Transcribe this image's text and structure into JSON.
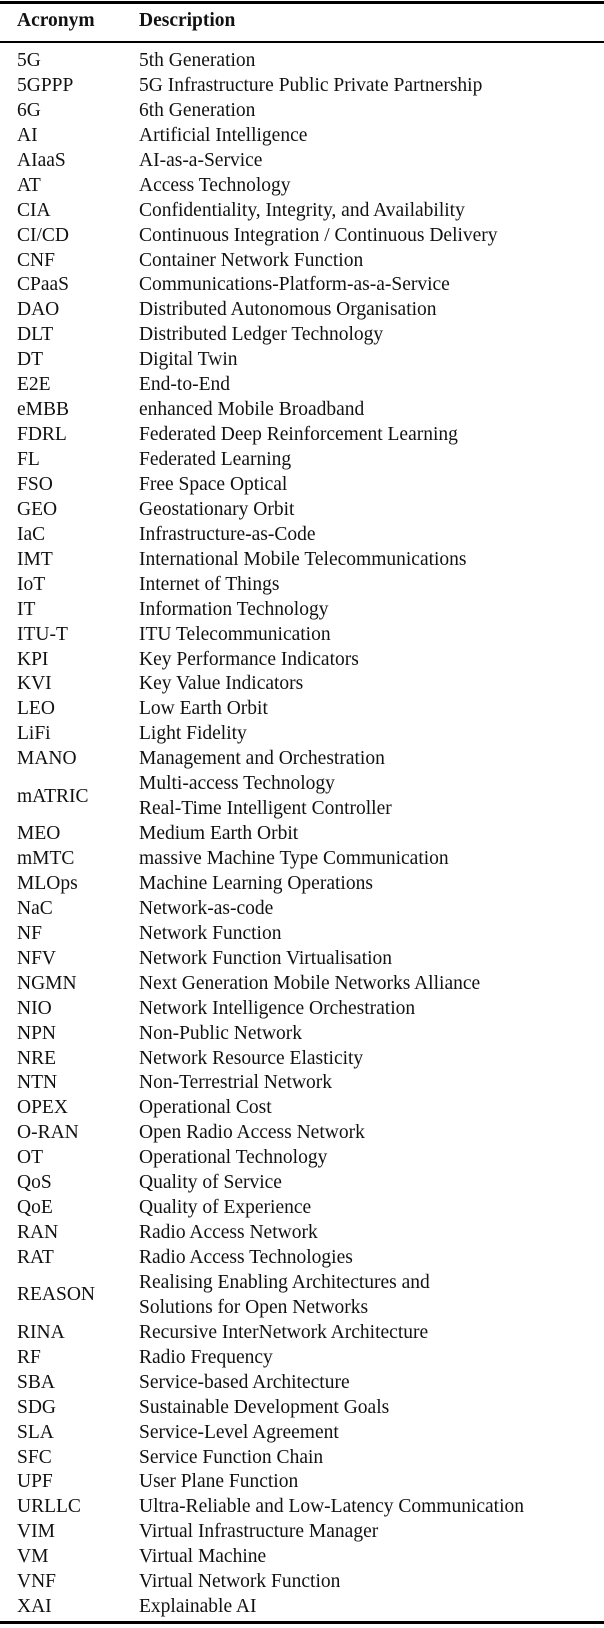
{
  "header": {
    "acronym": "Acronym",
    "description": "Description"
  },
  "rows": [
    {
      "acronym": "5G",
      "description": [
        "5th Generation"
      ]
    },
    {
      "acronym": "5GPPP",
      "description": [
        "5G Infrastructure Public Private Partnership"
      ]
    },
    {
      "acronym": "6G",
      "description": [
        "6th Generation"
      ]
    },
    {
      "acronym": "AI",
      "description": [
        "Artificial Intelligence"
      ]
    },
    {
      "acronym": "AIaaS",
      "description": [
        "AI-as-a-Service"
      ]
    },
    {
      "acronym": "AT",
      "description": [
        "Access Technology"
      ]
    },
    {
      "acronym": "CIA",
      "description": [
        "Confidentiality, Integrity, and Availability"
      ]
    },
    {
      "acronym": "CI/CD",
      "description": [
        "Continuous Integration / Continuous Delivery"
      ]
    },
    {
      "acronym": "CNF",
      "description": [
        "Container Network Function"
      ]
    },
    {
      "acronym": "CPaaS",
      "description": [
        "Communications-Platform-as-a-Service"
      ]
    },
    {
      "acronym": "DAO",
      "description": [
        "Distributed Autonomous Organisation"
      ]
    },
    {
      "acronym": "DLT",
      "description": [
        "Distributed Ledger Technology"
      ]
    },
    {
      "acronym": "DT",
      "description": [
        "Digital Twin"
      ]
    },
    {
      "acronym": "E2E",
      "description": [
        "End-to-End"
      ]
    },
    {
      "acronym": "eMBB",
      "description": [
        "enhanced Mobile Broadband"
      ]
    },
    {
      "acronym": "FDRL",
      "description": [
        "Federated Deep Reinforcement Learning"
      ]
    },
    {
      "acronym": "FL",
      "description": [
        "Federated Learning"
      ]
    },
    {
      "acronym": "FSO",
      "description": [
        "Free Space Optical"
      ]
    },
    {
      "acronym": "GEO",
      "description": [
        "Geostationary Orbit"
      ]
    },
    {
      "acronym": "IaC",
      "description": [
        "Infrastructure-as-Code"
      ]
    },
    {
      "acronym": "IMT",
      "description": [
        "International Mobile Telecommunications"
      ]
    },
    {
      "acronym": "IoT",
      "description": [
        "Internet of Things"
      ]
    },
    {
      "acronym": "IT",
      "description": [
        "Information Technology"
      ]
    },
    {
      "acronym": "ITU-T",
      "description": [
        "ITU Telecommunication"
      ]
    },
    {
      "acronym": "KPI",
      "description": [
        "Key Performance Indicators"
      ]
    },
    {
      "acronym": "KVI",
      "description": [
        "Key Value Indicators"
      ]
    },
    {
      "acronym": "LEO",
      "description": [
        "Low Earth Orbit"
      ]
    },
    {
      "acronym": "LiFi",
      "description": [
        "Light Fidelity"
      ]
    },
    {
      "acronym": "MANO",
      "description": [
        "Management and Orchestration"
      ]
    },
    {
      "acronym": "mATRIC",
      "description": [
        "Multi-access Technology",
        "Real-Time Intelligent Controller"
      ]
    },
    {
      "acronym": "MEO",
      "description": [
        "Medium Earth Orbit"
      ]
    },
    {
      "acronym": "mMTC",
      "description": [
        "massive Machine Type Communication"
      ]
    },
    {
      "acronym": "MLOps",
      "description": [
        "Machine Learning Operations"
      ]
    },
    {
      "acronym": "NaC",
      "description": [
        "Network-as-code"
      ]
    },
    {
      "acronym": "NF",
      "description": [
        "Network Function"
      ]
    },
    {
      "acronym": "NFV",
      "description": [
        "Network Function Virtualisation"
      ]
    },
    {
      "acronym": "NGMN",
      "description": [
        "Next Generation Mobile Networks Alliance"
      ]
    },
    {
      "acronym": "NIO",
      "description": [
        "Network Intelligence Orchestration"
      ]
    },
    {
      "acronym": "NPN",
      "description": [
        "Non-Public Network"
      ]
    },
    {
      "acronym": "NRE",
      "description": [
        "Network Resource Elasticity"
      ]
    },
    {
      "acronym": "NTN",
      "description": [
        "Non-Terrestrial Network"
      ]
    },
    {
      "acronym": "OPEX",
      "description": [
        "Operational Cost"
      ]
    },
    {
      "acronym": "O-RAN",
      "description": [
        "Open Radio Access Network"
      ]
    },
    {
      "acronym": "OT",
      "description": [
        "Operational Technology"
      ]
    },
    {
      "acronym": "QoS",
      "description": [
        "Quality of Service"
      ]
    },
    {
      "acronym": "QoE",
      "description": [
        "Quality of Experience"
      ]
    },
    {
      "acronym": "RAN",
      "description": [
        "Radio Access Network"
      ]
    },
    {
      "acronym": "RAT",
      "description": [
        "Radio Access Technologies"
      ]
    },
    {
      "acronym": "REASON",
      "description": [
        "Realising Enabling Architectures and",
        "Solutions for Open Networks"
      ]
    },
    {
      "acronym": "RINA",
      "description": [
        "Recursive InterNetwork Architecture"
      ]
    },
    {
      "acronym": "RF",
      "description": [
        "Radio Frequency"
      ]
    },
    {
      "acronym": "SBA",
      "description": [
        "Service-based Architecture"
      ]
    },
    {
      "acronym": "SDG",
      "description": [
        "Sustainable Development Goals"
      ]
    },
    {
      "acronym": "SLA",
      "description": [
        "Service-Level Agreement"
      ]
    },
    {
      "acronym": "SFC",
      "description": [
        "Service Function Chain"
      ]
    },
    {
      "acronym": "UPF",
      "description": [
        "User Plane Function"
      ]
    },
    {
      "acronym": "URLLC",
      "description": [
        "Ultra-Reliable and Low-Latency Communication"
      ]
    },
    {
      "acronym": "VIM",
      "description": [
        "Virtual Infrastructure Manager"
      ]
    },
    {
      "acronym": "VM",
      "description": [
        "Virtual Machine"
      ]
    },
    {
      "acronym": "VNF",
      "description": [
        "Virtual Network Function"
      ]
    },
    {
      "acronym": "XAI",
      "description": [
        "Explainable AI"
      ]
    }
  ]
}
